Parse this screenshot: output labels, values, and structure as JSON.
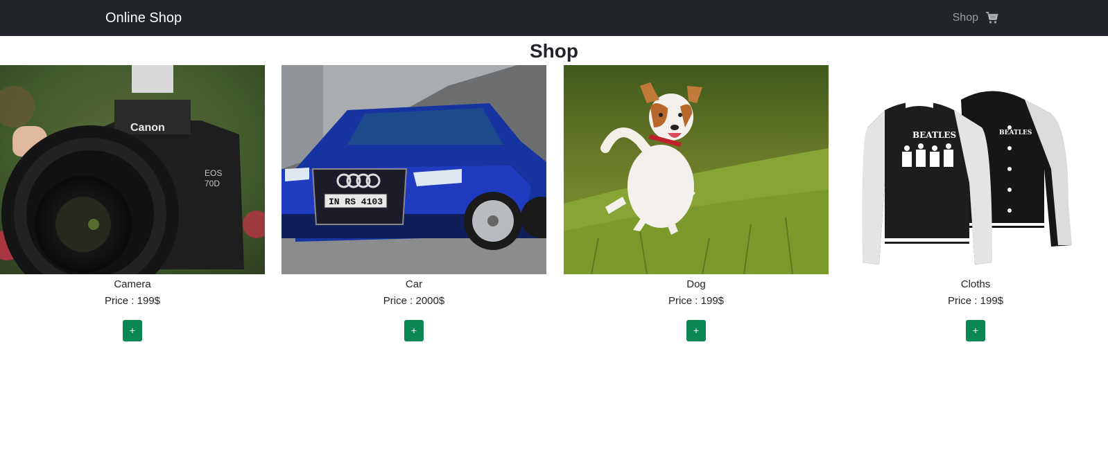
{
  "navbar": {
    "brand": "Online Shop",
    "shop_link": "Shop",
    "cart_icon": "shopping-cart-icon"
  },
  "page": {
    "title": "Shop"
  },
  "products": [
    {
      "name": "Camera",
      "price": "Price : 199$",
      "add_label": "+"
    },
    {
      "name": "Car",
      "price": "Price : 2000$",
      "add_label": "+"
    },
    {
      "name": "Dog",
      "price": "Price : 199$",
      "add_label": "+"
    },
    {
      "name": "Cloths",
      "price": "Price : 199$",
      "add_label": "+"
    }
  ],
  "colors": {
    "navbar_bg": "#212529",
    "button_green": "#0b8754"
  }
}
